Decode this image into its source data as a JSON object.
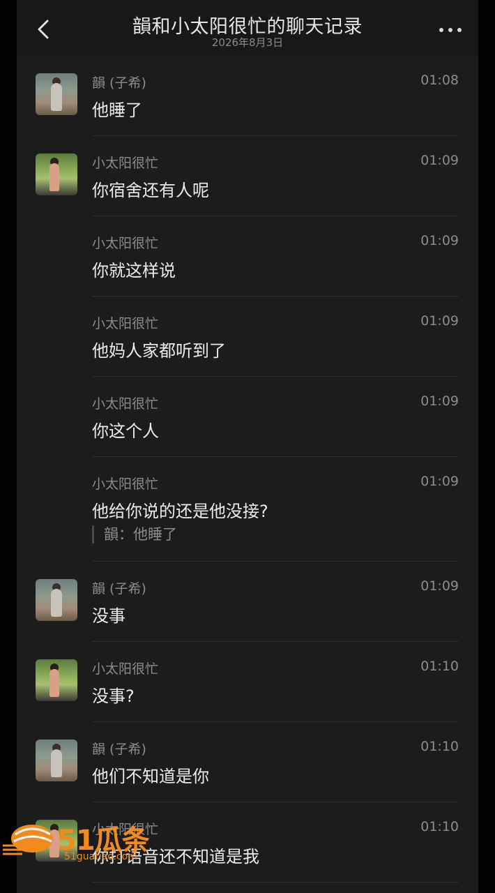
{
  "header": {
    "title": "韻和小太阳很忙的聊天记录",
    "date": "2026年8月3日",
    "back_icon": "chevron-left-icon",
    "more_icon": "more-dots-icon"
  },
  "messages": [
    {
      "sender": "韻 (子希)",
      "time": "01:08",
      "text": "他睡了",
      "avatar": "avatar-yun"
    },
    {
      "sender": "小太阳很忙",
      "time": "01:09",
      "text": "你宿舍还有人呢",
      "avatar": "avatar-xiaotaiyang"
    },
    {
      "sender": "小太阳很忙",
      "time": "01:09",
      "text": "你就这样说",
      "avatar": ""
    },
    {
      "sender": "小太阳很忙",
      "time": "01:09",
      "text": "他妈人家都听到了",
      "avatar": ""
    },
    {
      "sender": "小太阳很忙",
      "time": "01:09",
      "text": "你这个人",
      "avatar": ""
    },
    {
      "sender": "小太阳很忙",
      "time": "01:09",
      "text": "他给你说的还是他没接?",
      "quote": "韻：他睡了",
      "avatar": ""
    },
    {
      "sender": "韻 (子希)",
      "time": "01:09",
      "text": "没事",
      "avatar": "avatar-yun"
    },
    {
      "sender": "小太阳很忙",
      "time": "01:10",
      "text": "没事?",
      "avatar": "avatar-xiaotaiyang"
    },
    {
      "sender": "韻 (子希)",
      "time": "01:10",
      "text": "他们不知道是你",
      "avatar": "avatar-yun"
    },
    {
      "sender": "小太阳很忙",
      "time": "01:10",
      "text": "你打语音还不知道是我",
      "avatar": "avatar-xiaotaiyang"
    }
  ],
  "watermark": {
    "brand": "51瓜条",
    "url": "51guatiao.com"
  },
  "colors": {
    "background": "#1c1c1c",
    "header": "#181818",
    "text": "#ececec",
    "muted": "#8c8c8c",
    "watermark": "#f28a1e"
  }
}
